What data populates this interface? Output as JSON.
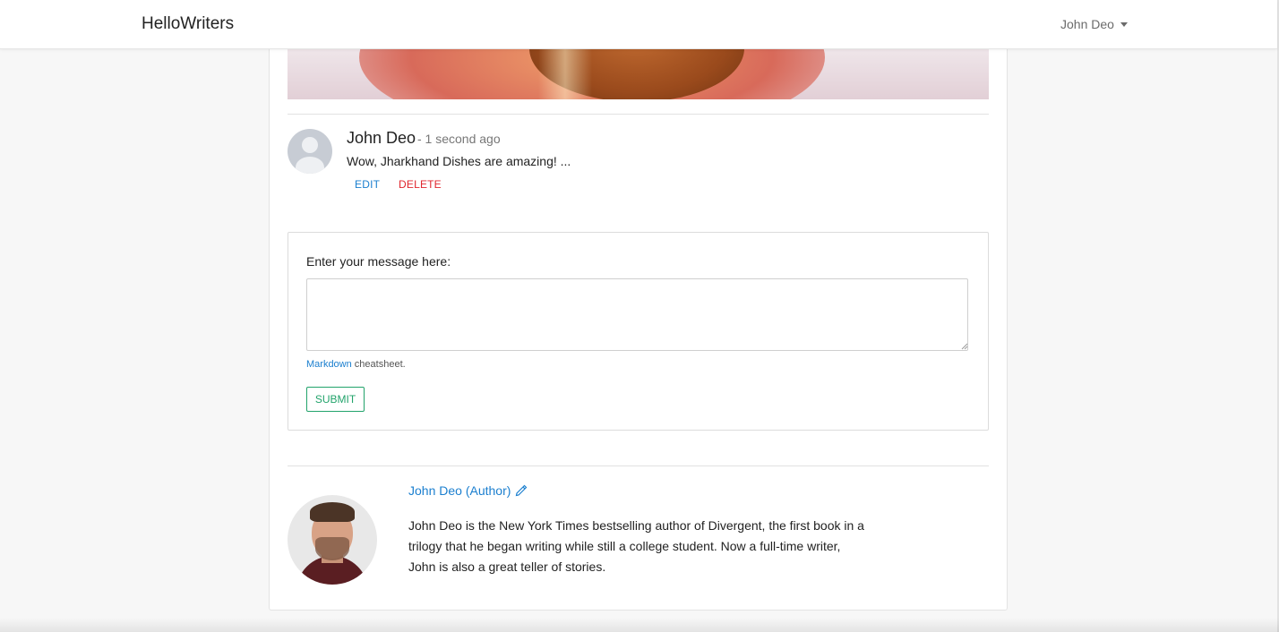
{
  "navbar": {
    "brand": "HelloWriters",
    "user_name": "John Deo"
  },
  "comment": {
    "author": "John Deo",
    "time": "- 1 second ago",
    "text": "Wow, Jharkhand Dishes are amazing! ...",
    "edit_label": "EDIT",
    "delete_label": "DELETE"
  },
  "comment_form": {
    "label": "Enter your message here:",
    "message_value": "",
    "help_link": "Markdown",
    "help_suffix": " cheatsheet.",
    "submit_label": "SUBMIT"
  },
  "author_box": {
    "name": "John Deo (Author)",
    "bio": "John Deo is the New York Times bestselling author of Divergent, the first book in a trilogy that he began writing while still a college student. Now a full-time writer, John is also a great teller of stories."
  },
  "colors": {
    "link": "#1b7fcf",
    "delete": "#e0262e",
    "submit": "#22a36b"
  },
  "icons": [
    "caret-down-icon",
    "pencil-icon",
    "user-placeholder-icon",
    "resize-grip-icon"
  ]
}
